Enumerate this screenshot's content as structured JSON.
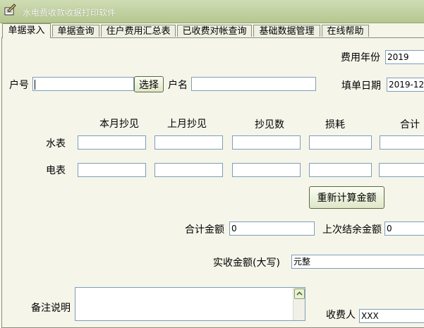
{
  "window": {
    "title": "水电费收款收据打印软件"
  },
  "tabs": [
    {
      "label": "单据录入"
    },
    {
      "label": "单据查询"
    },
    {
      "label": "住户费用汇总表"
    },
    {
      "label": "已收费对帐查询"
    },
    {
      "label": "基础数据管理"
    },
    {
      "label": "在线帮助"
    }
  ],
  "form": {
    "fee_year_label": "费用年份",
    "fee_year_value": "2019",
    "account_no_label": "户号",
    "account_no_value": "",
    "select_button": "选择",
    "account_name_label": "户名",
    "account_name_value": "",
    "fill_date_label": "填单日期",
    "fill_date_value": "2019-12",
    "columns": {
      "current_reading": "本月抄见",
      "last_reading": "上月抄见",
      "reading_count": "抄见数",
      "loss": "损耗",
      "total": "合计"
    },
    "water_meter_label": "水表",
    "electric_meter_label": "电表",
    "recalc_button": "重新计算金额",
    "total_amount_label": "合计金额",
    "total_amount_value": "0",
    "last_balance_label": "上次结余金额",
    "last_balance_value": "0",
    "actual_amount_label": "实收金额(大写)",
    "actual_amount_value": "元整",
    "remarks_label": "备注说明",
    "collector_label": "收费人",
    "collector_value": "XXX"
  }
}
